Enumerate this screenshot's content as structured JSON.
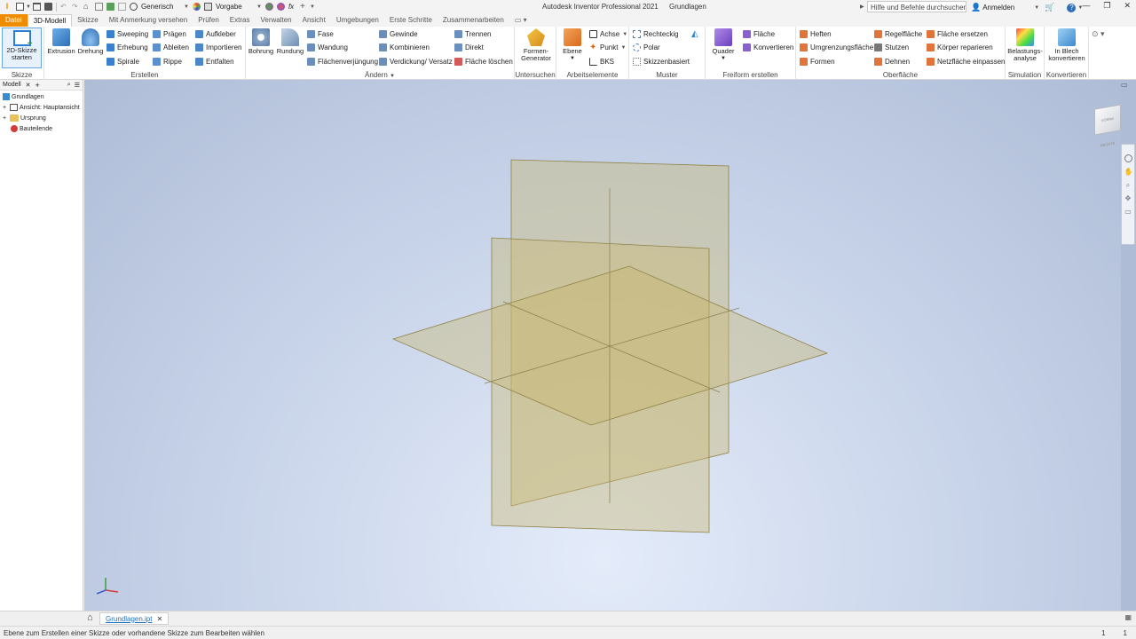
{
  "titlebar": {
    "app_title": "Autodesk Inventor Professional 2021",
    "doc_title": "Grundlagen",
    "material": "Generisch",
    "appearance": "Vorgabe",
    "search_placeholder": "Hilfe und Befehle durchsuchen...",
    "signin": "Anmelden"
  },
  "tabs": [
    "Datei",
    "3D-Modell",
    "Skizze",
    "Mit Anmerkung versehen",
    "Prüfen",
    "Extras",
    "Verwalten",
    "Ansicht",
    "Umgebungen",
    "Erste Schritte",
    "Zusammenarbeiten"
  ],
  "ribbon": {
    "skizze": {
      "label": "Skizze",
      "btn": "2D-Skizze starten"
    },
    "erstellen": {
      "label": "Erstellen",
      "extrusion": "Extrusion",
      "drehung": "Drehung",
      "col1": [
        "Sweeping",
        "Erhebung",
        "Spirale"
      ],
      "col2": [
        "Prägen",
        "Ableiten",
        "Rippe"
      ],
      "col3": [
        "Aufkleber",
        "Importieren",
        "Entfalten"
      ]
    },
    "aendern": {
      "label": "Ändern",
      "bohrung": "Bohrung",
      "rundung": "Rundung",
      "col1": [
        "Fase",
        "Wandung",
        "Flächenverjüngung"
      ],
      "col2": [
        "Gewinde",
        "Kombinieren",
        "Verdickung/ Versatz"
      ],
      "col3": [
        "Trennen",
        "Direkt",
        "Fläche löschen"
      ]
    },
    "untersuchen": {
      "label": "Untersuchen",
      "btn": "Formen-Generator"
    },
    "arbeitselemente": {
      "label": "Arbeitselemente",
      "ebene": "Ebene",
      "col": [
        "Achse",
        "Punkt",
        "BKS"
      ]
    },
    "muster": {
      "label": "Muster",
      "col": [
        "Rechteckig",
        "Polar",
        "Skizzenbasiert"
      ]
    },
    "freiform": {
      "label": "Freiform erstellen",
      "quader": "Quader",
      "col": [
        "Fläche",
        "Konvertieren"
      ]
    },
    "oberflaeche": {
      "label": "Oberfläche",
      "col1": [
        "Heften",
        "Umgrenzungsfläche",
        "Formen"
      ],
      "col2": [
        "Regelfläche",
        "Stutzen",
        "Dehnen"
      ],
      "col3": [
        "Fläche ersetzen",
        "Körper reparieren",
        "Netzfläche einpassen"
      ]
    },
    "simulation": {
      "label": "Simulation",
      "btn": "Belastungs-analyse"
    },
    "konvertieren": {
      "label": "Konvertieren",
      "btn": "In Blech konvertieren"
    }
  },
  "browser": {
    "tab": "Modell",
    "root": "Grundlagen",
    "nodes": [
      "Ansicht: Hauptansicht",
      "Ursprung",
      "Bauteilende"
    ]
  },
  "viewcube": {
    "face": "VORNE",
    "side": "RECHTS"
  },
  "doctab": {
    "name": "Grundlagen.ipt"
  },
  "status": {
    "message": "Ebene zum Erstellen einer Skizze oder vorhandene Skizze zum Bearbeiten wählen",
    "count1": "1",
    "count2": "1"
  },
  "colors": {
    "file_tab": "#f08c00",
    "plane_fill": "#c8b872",
    "plane_edge": "#8f8248",
    "accent": "#1f6fbf"
  }
}
